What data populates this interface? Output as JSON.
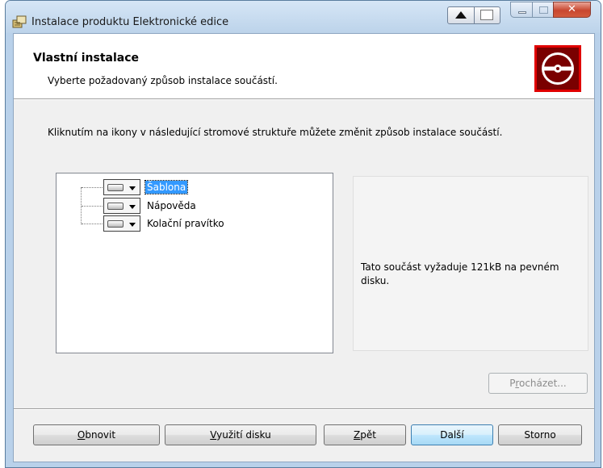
{
  "window": {
    "title": "Instalace produktu Elektronické edice",
    "icons": {
      "app": "installer-icon",
      "scroll_up": "triangle-up-icon",
      "image": "image-icon",
      "minimize": "minimize-icon",
      "maximize": "maximize-icon",
      "close": "close-icon"
    }
  },
  "header": {
    "title": "Vlastní instalace",
    "subtitle": "Vyberte požadovaný způsob instalace součástí.",
    "logo_icon": "cd-disc-icon"
  },
  "instructions": "Kliknutím na ikony v následující stromové struktuře můžete změnit způsob instalace součástí.",
  "tree": {
    "items": [
      {
        "label": "Šablona",
        "selected": true,
        "icon": "disk-dropdown-icon"
      },
      {
        "label": "Nápověda",
        "selected": false,
        "icon": "disk-dropdown-icon"
      },
      {
        "label": "Kolační pravítko",
        "selected": false,
        "icon": "disk-dropdown-icon"
      }
    ]
  },
  "description": {
    "text": "Tato součást vyžaduje 121kB na pevném disku."
  },
  "browse": {
    "pre": "P",
    "key": "r",
    "post": "ocházet..."
  },
  "buttons": {
    "reset": {
      "key": "O",
      "rest": "bnovit"
    },
    "disk_usage": {
      "key": "V",
      "rest": "yužití disku"
    },
    "back": {
      "key": "Z",
      "rest": "pět"
    },
    "next": {
      "label": "Další"
    },
    "cancel": {
      "label": "Storno"
    }
  },
  "colors": {
    "logo_red": "#cc0000",
    "selection": "#3399ff",
    "frame": "#b9d1ea",
    "close_button": "#c8472f"
  }
}
